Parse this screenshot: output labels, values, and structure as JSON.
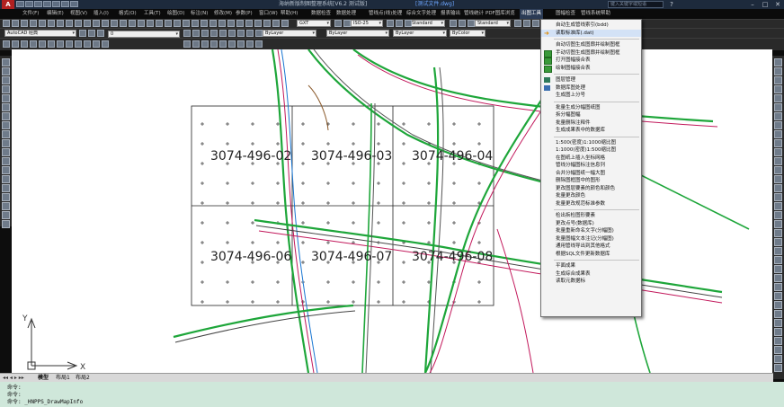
{
  "window": {
    "title": "海纳新版制图整理系统[V6.2 测试版]",
    "file": "[测试文件.dwg]",
    "search_placeholder": "键入关键字或短语",
    "min": "–",
    "max": "□",
    "close": "✕"
  },
  "menubar": [
    "文件(F)",
    "编辑(E)",
    "视图(V)",
    "插入(I)",
    "格式(O)",
    "工具(T)",
    "绘图(D)",
    "标注(N)",
    "修改(M)",
    "参数(P)",
    "窗口(W)",
    "帮助(H)",
    "数据检查",
    "数据处理",
    "管线点(线)处理",
    "综合文字处理",
    "报表输出",
    "管线统计",
    "PDF图库浏览",
    "出图工具",
    "图幅检查",
    "管线系统帮助"
  ],
  "menubar_active": "出图工具",
  "toolbar": {
    "workspace": "AutoCAD 经典",
    "layer": "0",
    "textstyle": "GXT",
    "dimstyle": "ISO-25",
    "tablestyle": "Standard",
    "mlstyle": "Standard",
    "color": "ByLayer",
    "linetype": "ByLayer",
    "lineweight": "ByLayer",
    "plotstyle": "ByColor",
    "color2": "ByLayer"
  },
  "drawing": {
    "sheets": [
      "3074-496-02",
      "3074-496-03",
      "3074-496-04",
      "3074-496-06",
      "3074-496-07",
      "3074-496-08"
    ],
    "ucs_x": "X",
    "ucs_y": "Y"
  },
  "tabs": [
    "模型",
    "布局1",
    "布局2"
  ],
  "command": {
    "lines": [
      "命令:",
      "命令:",
      "命令: _HNPPS_DrawMapInfo"
    ]
  },
  "dropdown": [
    {
      "label": "自动生成管线索引(bdd)",
      "icon": "none"
    },
    {
      "label": "读取标准库(.dat)",
      "icon": "arrow-icon"
    },
    {
      "sep": true
    },
    {
      "label": "自动切图生成图廓并绘制图框",
      "icon": "none"
    },
    {
      "label": "手动切图生成图廓并绘制图框",
      "icon": "grid-icon"
    },
    {
      "label": "打开图幅接合表",
      "icon": "grid-icon"
    },
    {
      "label": "绘制图幅接合表",
      "icon": "grid-icon"
    },
    {
      "sep": true
    },
    {
      "label": "图层管理",
      "icon": "layer-icon"
    },
    {
      "label": "数据库图处理",
      "icon": "db-icon"
    },
    {
      "label": "生成图上分号",
      "icon": "none"
    },
    {
      "sep": true
    },
    {
      "label": "批量生成分幅图纸图",
      "icon": "none"
    },
    {
      "label": "拆分幅图幅",
      "icon": "none"
    },
    {
      "label": "批量删除注释件",
      "icon": "none"
    },
    {
      "label": "生成成果表中的数据库",
      "icon": "none"
    },
    {
      "sep": true
    },
    {
      "label": "1:500(密度)1:1000缩比图",
      "icon": "none"
    },
    {
      "label": "1:1000(密度)1:500缩比图",
      "icon": "none"
    },
    {
      "label": "在图纸上插入坐标网格",
      "icon": "none"
    },
    {
      "label": "管线分幅图标注信息列",
      "icon": "none"
    },
    {
      "label": "合并分幅图纸一幅大图",
      "icon": "none"
    },
    {
      "label": "删除图框图中的图形",
      "icon": "none"
    },
    {
      "label": "更改图层要素的颜色和颜色",
      "icon": "none"
    },
    {
      "label": "批量更改颜色",
      "icon": "none"
    },
    {
      "label": "批量更改规范标准参数",
      "icon": "none"
    },
    {
      "sep": true
    },
    {
      "label": "检出拆检图形要素",
      "icon": "none"
    },
    {
      "label": "更改点号(数据库)",
      "icon": "none"
    },
    {
      "label": "批量重新命名文字(分幅图)",
      "icon": "none"
    },
    {
      "label": "批量图幅文本注记(分幅图)",
      "icon": "none"
    },
    {
      "label": "通用管线导出到其他格式",
      "icon": "none"
    },
    {
      "label": "根据SQL文件更新数据库",
      "icon": "none"
    },
    {
      "sep": true
    },
    {
      "label": "平面成果",
      "icon": "none"
    },
    {
      "label": "生成综合成果表",
      "icon": "none"
    },
    {
      "label": "读取元数据标",
      "icon": "none"
    }
  ],
  "colors": {
    "menu_highlight": "#d3e2f6",
    "command_bg": "#cfe7da",
    "drawing_bg": "#ffffff"
  }
}
